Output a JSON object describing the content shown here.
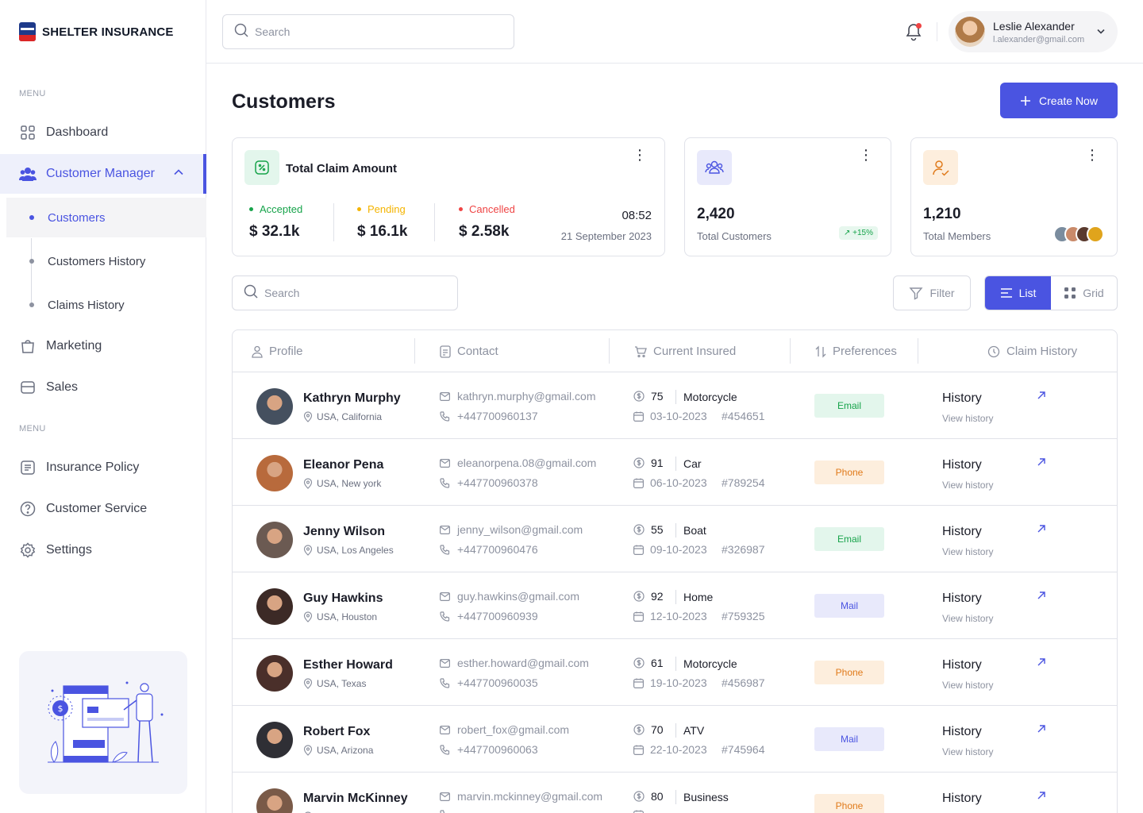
{
  "app": {
    "brand": "SHELTER INSURANCE"
  },
  "search": {
    "placeholder": "Search"
  },
  "user": {
    "name": "Leslie Alexander",
    "email": "l.alexander@gmail.com"
  },
  "sidebar": {
    "caption1": "MENU",
    "caption2": "MENU",
    "items": [
      {
        "label": "Dashboard",
        "icon": "grid-icon"
      },
      {
        "label": "Customer Manager",
        "icon": "users-icon"
      },
      {
        "label": "Marketing",
        "icon": "bag-icon"
      },
      {
        "label": "Sales",
        "icon": "card-icon"
      },
      {
        "label": "Insurance Policy",
        "icon": "document-icon"
      },
      {
        "label": "Customer Service",
        "icon": "help-icon"
      },
      {
        "label": "Settings",
        "icon": "gear-icon"
      }
    ],
    "subitems": [
      {
        "label": "Customers"
      },
      {
        "label": "Customers History"
      },
      {
        "label": "Claims History"
      }
    ]
  },
  "main": {
    "title": "Customers",
    "create_label": "Create Now",
    "claim": {
      "title": "Total Claim Amount",
      "accepted_label": "Accepted",
      "accepted_value": "$ 32.1k",
      "pending_label": "Pending",
      "pending_value": "$ 16.1k",
      "cancelled_label": "Cancelled",
      "cancelled_value": "$ 2.58k",
      "time": "08:52",
      "date": "21 September 2023"
    },
    "customers_stat": {
      "value": "2,420",
      "label": "Total Customers",
      "growth": "+15%"
    },
    "members_stat": {
      "value": "1,210",
      "label": "Total Members"
    },
    "list_search_placeholder": "Search",
    "filter_label": "Filter",
    "list_label": "List",
    "grid_label": "Grid"
  },
  "colors": {
    "accent": "#4a54e1",
    "accepted": "#16a34a",
    "pending": "#f4b400",
    "cancelled": "#ef4444"
  },
  "table": {
    "headers": {
      "profile": "Profile",
      "contact": "Contact",
      "insured": "Current Insured",
      "preferences": "Preferences",
      "history": "Claim History"
    },
    "rows": [
      {
        "name": "Kathryn Murphy",
        "location": "USA, California",
        "email": "kathryn.murphy@gmail.com",
        "phone": "+447700960137",
        "amount": "75",
        "type": "Motorcycle",
        "date": "03-10-2023",
        "policy": "#454651",
        "pref": "Email",
        "history": "History",
        "history_sub": "View history"
      },
      {
        "name": "Eleanor Pena",
        "location": "USA, New york",
        "email": "eleanorpena.08@gmail.com",
        "phone": "+447700960378",
        "amount": "91",
        "type": "Car",
        "date": "06-10-2023",
        "policy": "#789254",
        "pref": "Phone",
        "history": "History",
        "history_sub": "View history"
      },
      {
        "name": "Jenny Wilson",
        "location": "USA, Los Angeles",
        "email": "jenny_wilson@gmail.com",
        "phone": "+447700960476",
        "amount": "55",
        "type": "Boat",
        "date": "09-10-2023",
        "policy": "#326987",
        "pref": "Email",
        "history": "History",
        "history_sub": "View history"
      },
      {
        "name": "Guy Hawkins",
        "location": "USA, Houston",
        "email": "guy.hawkins@gmail.com",
        "phone": "+447700960939",
        "amount": "92",
        "type": "Home",
        "date": "12-10-2023",
        "policy": "#759325",
        "pref": "Mail",
        "history": "History",
        "history_sub": "View history"
      },
      {
        "name": "Esther Howard",
        "location": "USA, Texas",
        "email": "esther.howard@gmail.com",
        "phone": "+447700960035",
        "amount": "61",
        "type": "Motorcycle",
        "date": "19-10-2023",
        "policy": "#456987",
        "pref": "Phone",
        "history": "History",
        "history_sub": "View history"
      },
      {
        "name": "Robert Fox",
        "location": "USA, Arizona",
        "email": "robert_fox@gmail.com",
        "phone": "+447700960063",
        "amount": "70",
        "type": "ATV",
        "date": "22-10-2023",
        "policy": "#745964",
        "pref": "Mail",
        "history": "History",
        "history_sub": "View history"
      },
      {
        "name": "Marvin McKinney",
        "location": "",
        "email": "marvin.mckinney@gmail.com",
        "phone": "",
        "amount": "80",
        "type": "Business",
        "date": "",
        "policy": "",
        "pref": "Phone",
        "history": "History",
        "history_sub": ""
      }
    ]
  }
}
